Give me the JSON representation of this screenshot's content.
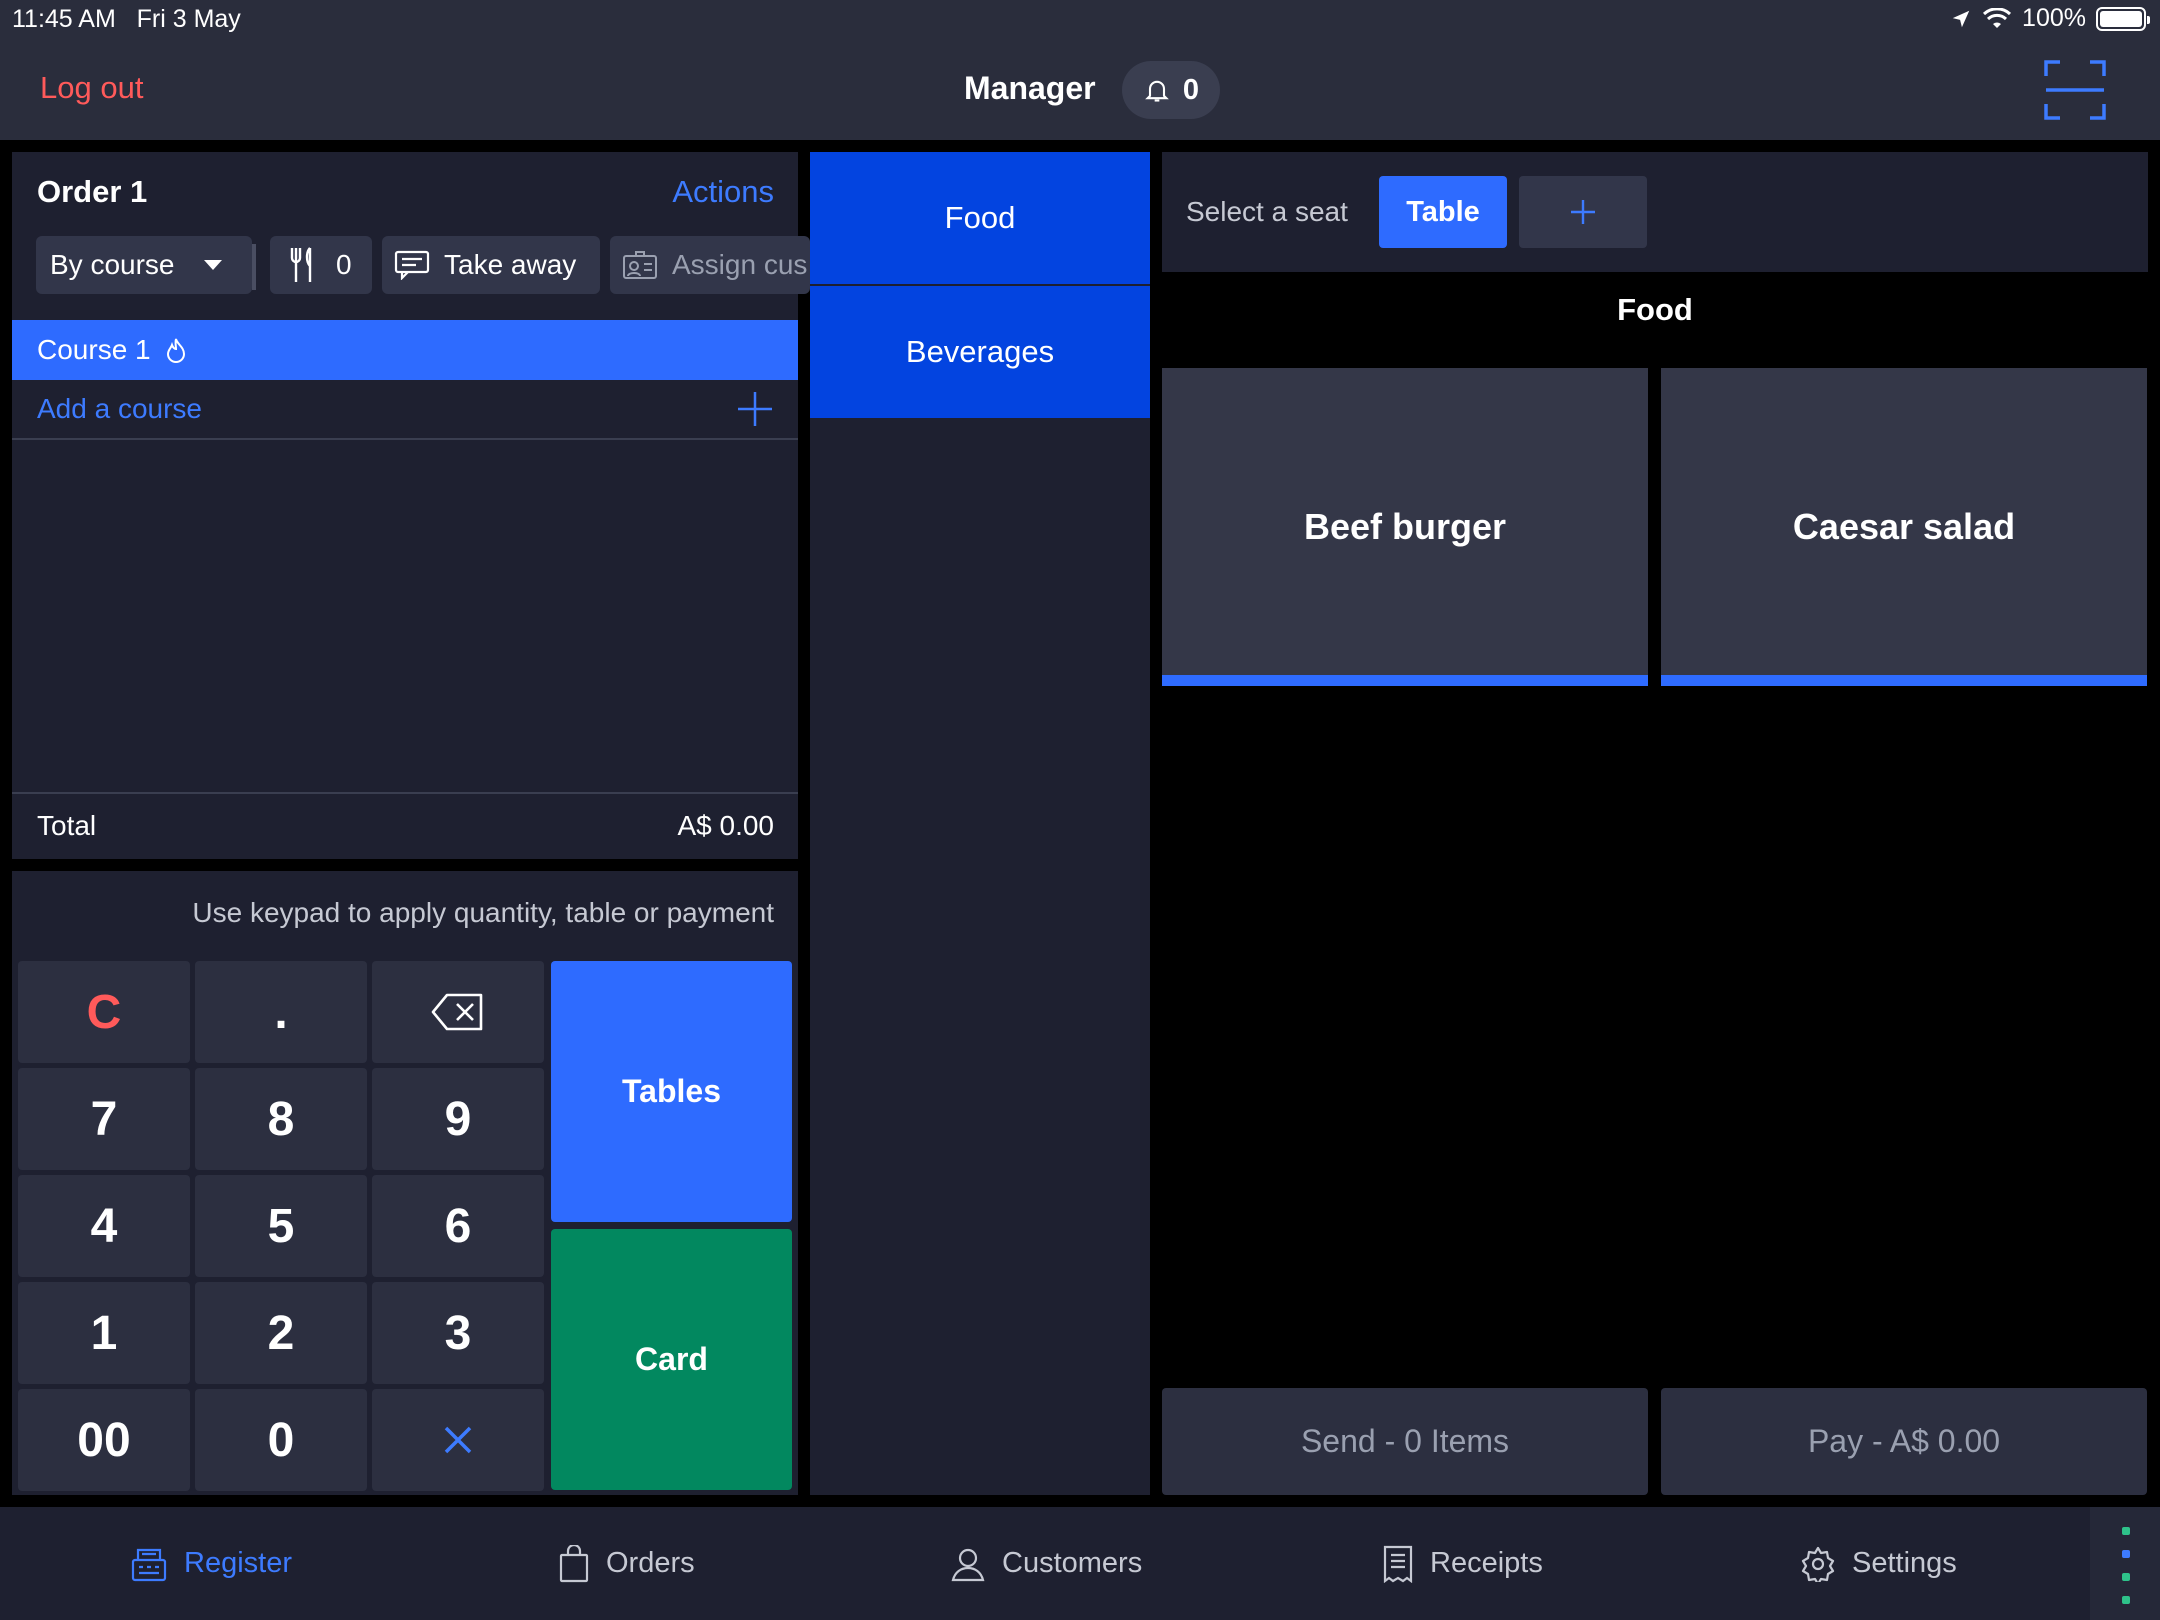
{
  "status_bar": {
    "time": "11:45 AM",
    "date": "Fri 3 May",
    "battery": "100%"
  },
  "header": {
    "logout": "Log out",
    "user": "Manager",
    "notifications": "0"
  },
  "order": {
    "title": "Order 1",
    "actions": "Actions",
    "mode": "By course",
    "guests": "0",
    "take_away": "Take away",
    "assign_customer": "Assign cus",
    "course": "Course 1",
    "add_course": "Add a course",
    "total_label": "Total",
    "total_value": "A$ 0.00"
  },
  "keypad": {
    "hint": "Use keypad to apply quantity, table or payment",
    "keys": {
      "clear": "C",
      "dot": ".",
      "k7": "7",
      "k8": "8",
      "k9": "9",
      "k4": "4",
      "k5": "5",
      "k6": "6",
      "k1": "1",
      "k2": "2",
      "k3": "3",
      "k00": "00",
      "k0": "0"
    },
    "tables": "Tables",
    "card": "Card"
  },
  "categories": [
    "Food",
    "Beverages"
  ],
  "seat": {
    "label": "Select a seat",
    "table": "Table"
  },
  "grid": {
    "title": "Food",
    "products": [
      "Beef burger",
      "Caesar salad"
    ]
  },
  "footer_actions": {
    "send": "Send - 0 Items",
    "pay": "Pay - A$ 0.00"
  },
  "tabs": [
    "Register",
    "Orders",
    "Customers",
    "Receipts",
    "Settings"
  ],
  "colors": {
    "accent": "#2e6bff",
    "card": "#02885f",
    "logout": "#ff5a5a",
    "category": "#0344e0"
  }
}
